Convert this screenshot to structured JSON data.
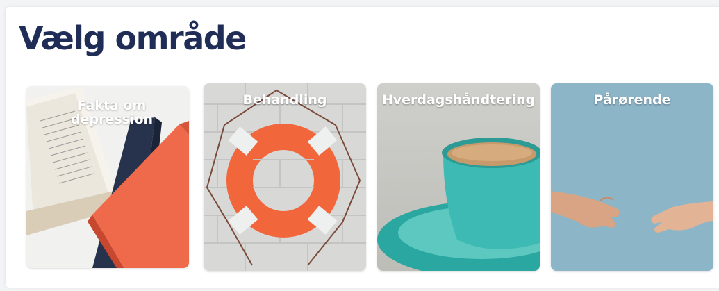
{
  "page": {
    "title": "Vælg område"
  },
  "cards": [
    {
      "label": "Fakta om depression",
      "image": "books-image"
    },
    {
      "label": "Behandling",
      "image": "lifebuoy-image"
    },
    {
      "label": "Hverdagshåndtering",
      "image": "coffee-cup-image"
    },
    {
      "label": "Pårørende",
      "image": "reaching-hands-image"
    }
  ],
  "colors": {
    "title": "#1f2d57",
    "card_label": "#ffffff",
    "card4_background": "#8cb5c8",
    "lifebuoy": "#f2663c"
  }
}
